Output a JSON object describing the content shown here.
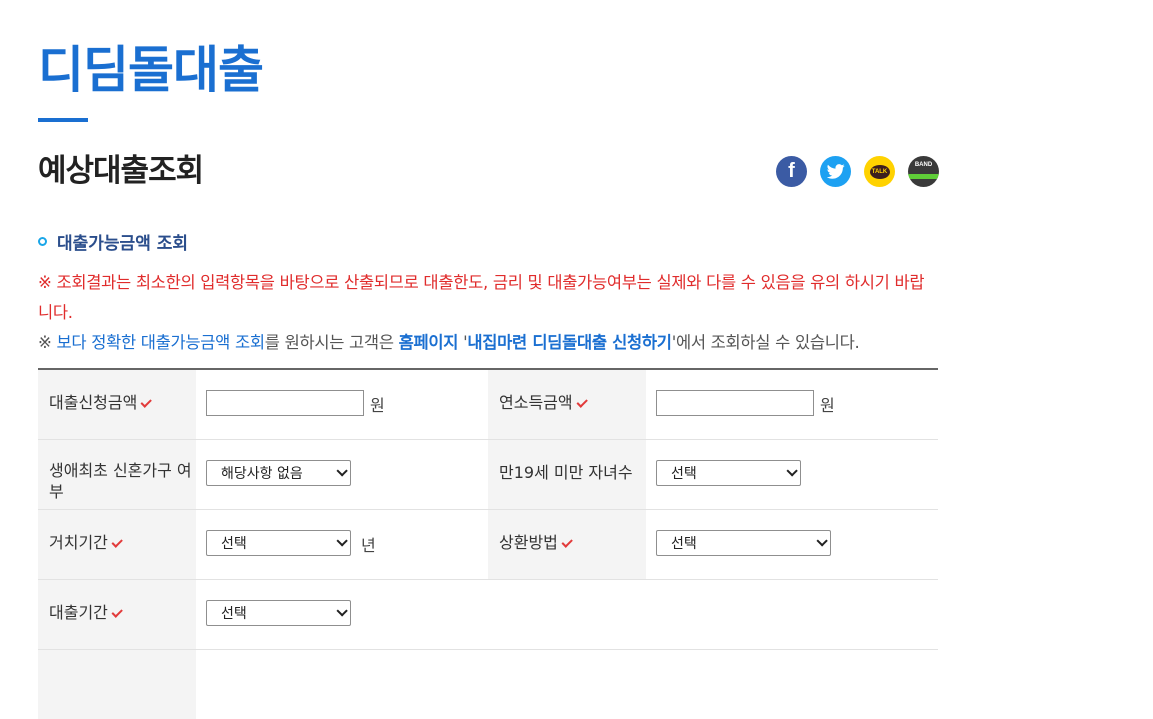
{
  "page": {
    "title": "디딤돌대출",
    "section_title": "예상대출조회"
  },
  "share": {
    "facebook": "f",
    "kakao": "TALK",
    "band": "BAND",
    "icons": [
      "facebook-icon",
      "twitter-icon",
      "kakaotalk-icon",
      "band-icon"
    ]
  },
  "subhead": "대출가능금액 조회",
  "notice": {
    "line1": "※ 조회결과는 최소한의 입력항목을 바탕으로 산출되므로 대출한도, 금리 및 대출가능여부는 실제와 다를 수 있음을 유의 하시기 바랍니다.",
    "line2_prefix": "※ ",
    "line2_link": "보다 정확한 대출가능금액 조회",
    "line2_mid": "를 원하시는 고객은 ",
    "line2_homepage": "홈페이지",
    "line2_quote_open": " '",
    "line2_menu": "내집마련 디딤돌대출 신청하기",
    "line2_quote_close": "'",
    "line2_suffix": "에서 조회하실 수 있습니다."
  },
  "form": {
    "loan_amount": {
      "label": "대출신청금액",
      "value": "",
      "unit": "원"
    },
    "annual_income": {
      "label": "연소득금액",
      "value": "",
      "unit": "원"
    },
    "first_newlywed": {
      "label": "생애최초 신혼가구 여부",
      "selected": "해당사항 없음"
    },
    "children_under19": {
      "label": "만19세 미만 자녀수",
      "selected": "선택"
    },
    "grace_period": {
      "label": "거치기간",
      "selected": "선택",
      "unit": "년"
    },
    "repayment_method": {
      "label": "상환방법",
      "selected": "선택"
    },
    "loan_term": {
      "label": "대출기간",
      "selected": "선택"
    }
  },
  "colors": {
    "brand_blue": "#1a6fd1",
    "notice_red": "#e02c2c",
    "required_check": "#e23b3b"
  }
}
